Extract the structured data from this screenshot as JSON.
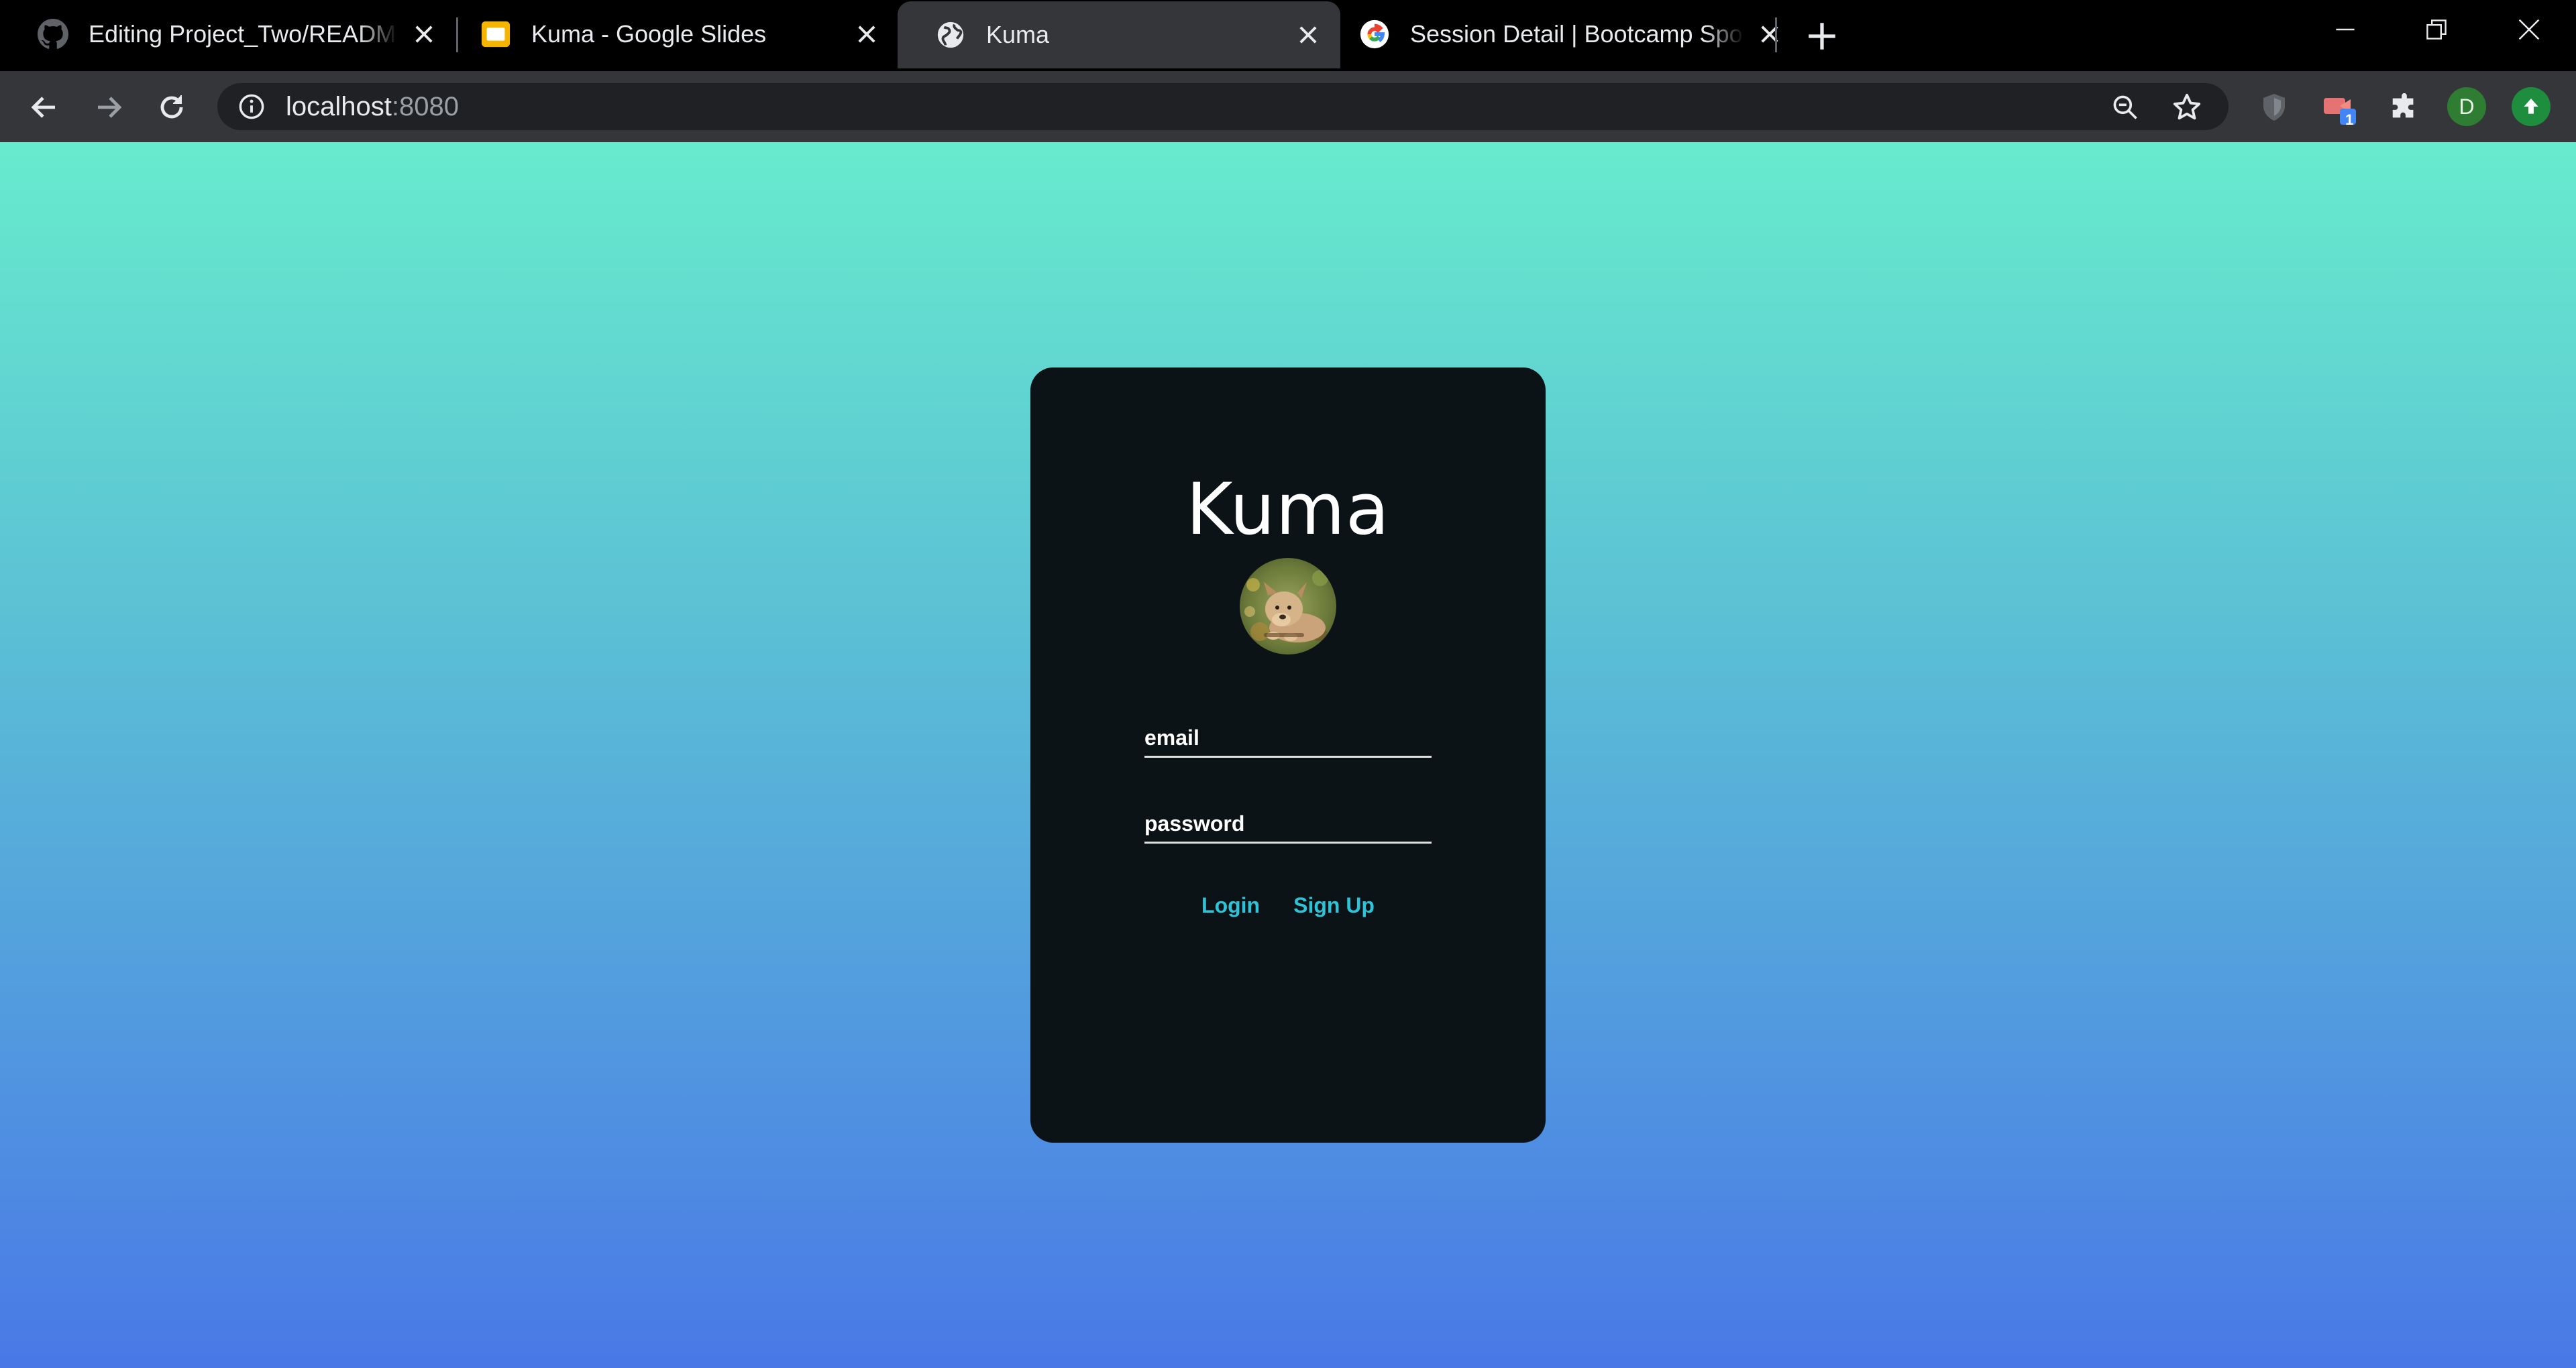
{
  "browser": {
    "tabs": [
      {
        "title": "Editing Project_Two/README.md",
        "icon": "github-icon",
        "active": false
      },
      {
        "title": "Kuma - Google Slides",
        "icon": "google-slides-icon",
        "active": false
      },
      {
        "title": "Kuma",
        "icon": "globe-icon",
        "active": true
      },
      {
        "title": "Session Detail | Bootcamp Spot",
        "icon": "google-icon",
        "active": false
      }
    ],
    "address": {
      "host": "localhost",
      "port": ":8080"
    },
    "profile_initial": "D",
    "extension_badge": "1"
  },
  "page": {
    "brand_title": "Kuma",
    "avatar_alt": "Kuma the dog",
    "email_placeholder": "email",
    "password_placeholder": "password",
    "login_label": "Login",
    "signup_label": "Sign Up"
  },
  "colors": {
    "gradient_top": "#67ebcd",
    "gradient_bottom": "#4978e6",
    "card": "#0b1316",
    "link": "#2ec3d6"
  }
}
